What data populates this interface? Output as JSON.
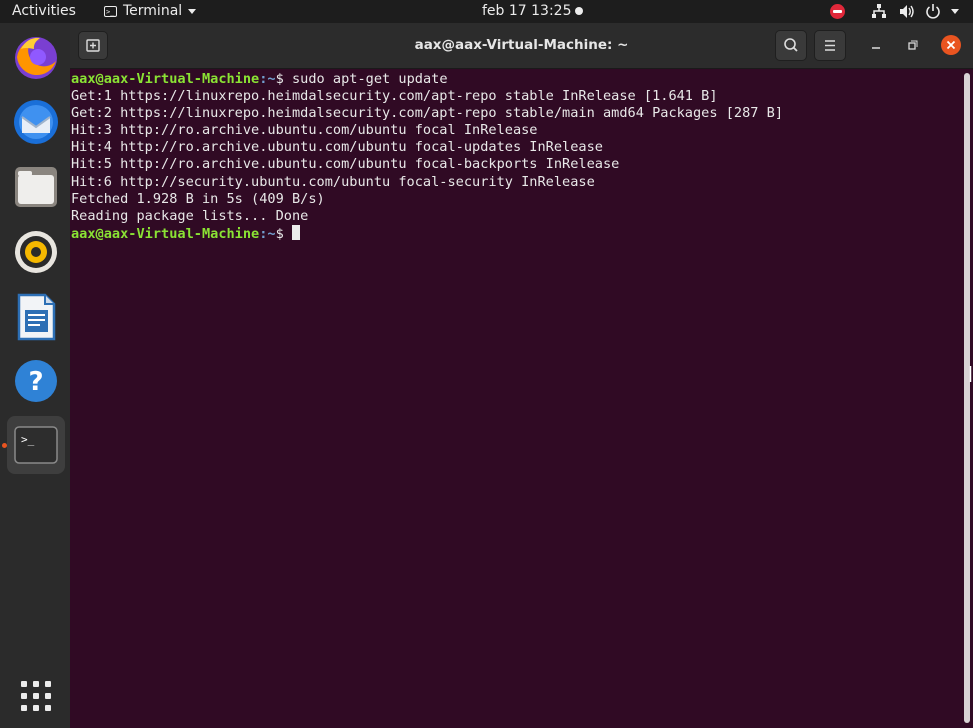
{
  "topbar": {
    "activities": "Activities",
    "app_menu": "Terminal",
    "app_menu_icon": "terminal-icon",
    "clock": "feb 17  13:25",
    "status_icons": [
      "do-not-disturb-icon",
      "network-icon",
      "volume-icon",
      "power-icon"
    ]
  },
  "dock": {
    "items": [
      {
        "name": "firefox",
        "icon": "firefox-icon"
      },
      {
        "name": "thunderbird",
        "icon": "thunderbird-icon"
      },
      {
        "name": "files",
        "icon": "files-icon"
      },
      {
        "name": "rhythmbox",
        "icon": "rhythmbox-icon"
      },
      {
        "name": "libreoffice-writer",
        "icon": "writer-icon"
      },
      {
        "name": "help",
        "icon": "help-icon"
      },
      {
        "name": "terminal",
        "icon": "terminal-icon",
        "active": true
      }
    ],
    "show_apps_icon": "grid-icon",
    "terminal_glyph": ">_",
    "help_glyph": "?"
  },
  "window": {
    "title": "aax@aax-Virtual-Machine: ~",
    "buttons": [
      "new-tab-icon",
      "search-icon",
      "hamburger-menu-icon",
      "minimize-icon",
      "maximize-icon",
      "close-icon"
    ]
  },
  "terminal": {
    "prompt_user": "aax@aax-Virtual-Machine",
    "prompt_path": ":~",
    "prompt_symbol": "$ ",
    "command": "sudo apt-get update",
    "output": [
      "Get:1 https://linuxrepo.heimdalsecurity.com/apt-repo stable InRelease [1.641 B]",
      "Get:2 https://linuxrepo.heimdalsecurity.com/apt-repo stable/main amd64 Packages [287 B]",
      "Hit:3 http://ro.archive.ubuntu.com/ubuntu focal InRelease",
      "Hit:4 http://ro.archive.ubuntu.com/ubuntu focal-updates InRelease",
      "Hit:5 http://ro.archive.ubuntu.com/ubuntu focal-backports InRelease",
      "Hit:6 http://security.ubuntu.com/ubuntu focal-security InRelease",
      "Fetched 1.928 B in 5s (409 B/s)",
      "Reading package lists... Done"
    ]
  },
  "colors": {
    "terminal_bg": "#300a24",
    "prompt_user": "#8ae234",
    "prompt_path": "#729fcf",
    "accent": "#e95420"
  }
}
